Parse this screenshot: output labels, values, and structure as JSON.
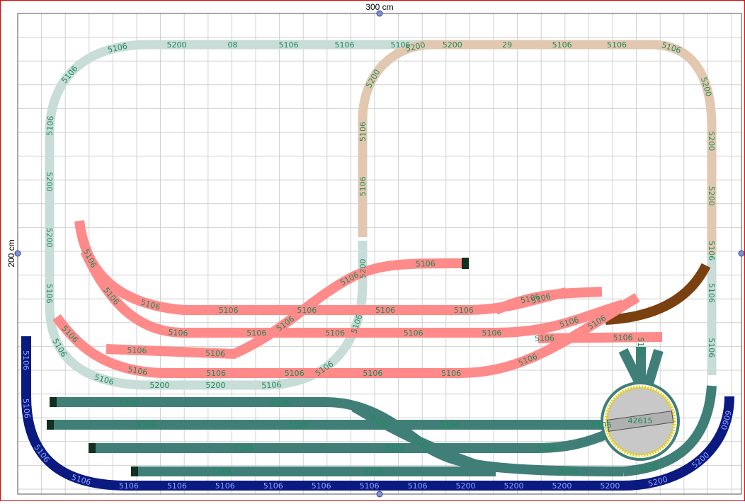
{
  "board": {
    "width_label": "300 cm",
    "height_label": "200 cm"
  },
  "colors": {
    "grid": "#d0d0d0",
    "board_border": "#505050",
    "frame": "#e00000",
    "track_label": "#1f8a5a",
    "loop_left": "#c8dcd8",
    "loop_right": "#e2c8b0",
    "yard_pink": "#ff8a8a",
    "yard_teal": "#3f7f78",
    "outer_navy": "#0a1a80",
    "brown_curve": "#7a4010",
    "turntable": "#c8c8c8",
    "turntable_ring": "#e8d000"
  },
  "labels": {
    "loop_left": [
      "5200",
      "08",
      "5106",
      "5106",
      "5106",
      "5106",
      "5106",
      "5106",
      "5200",
      "5200",
      "5106",
      "5106",
      "5106",
      "5200",
      "5200",
      "5106",
      "5106",
      "5106",
      "5200"
    ],
    "loop_right": [
      "5200",
      "29",
      "5106",
      "5106",
      "5106",
      "5200",
      "5200",
      "5200",
      "5106",
      "5106",
      "5106",
      "5200",
      "5200",
      "5106",
      "5106"
    ],
    "yard_pink": [
      "5106",
      "5106",
      "5106",
      "5106",
      "5106",
      "5106",
      "5106",
      "5106",
      "5106",
      "5106",
      "5106",
      "5106",
      "5106",
      "5106",
      "5106",
      "5106",
      "5106",
      "5106",
      "5106",
      "5106",
      "5106",
      "5106",
      "5106",
      "5106",
      "5106",
      "5106",
      "5106",
      "5106",
      "5106",
      "5106"
    ],
    "yard_teal": [
      "5106",
      "5106",
      "5106",
      "5106",
      "5106",
      "5106",
      "5106",
      "5106",
      "5106",
      "5106",
      "5106",
      "5106",
      "5106",
      "5106",
      "5106",
      "5106"
    ],
    "outer_navy": [
      "5106",
      "5106",
      "5106",
      "5106",
      "5106",
      "5106",
      "5106",
      "5106",
      "5106",
      "5106",
      "5106",
      "5200",
      "5200",
      "5200",
      "5200",
      "5200",
      "5200",
      "0909"
    ],
    "turntable": "42615"
  }
}
